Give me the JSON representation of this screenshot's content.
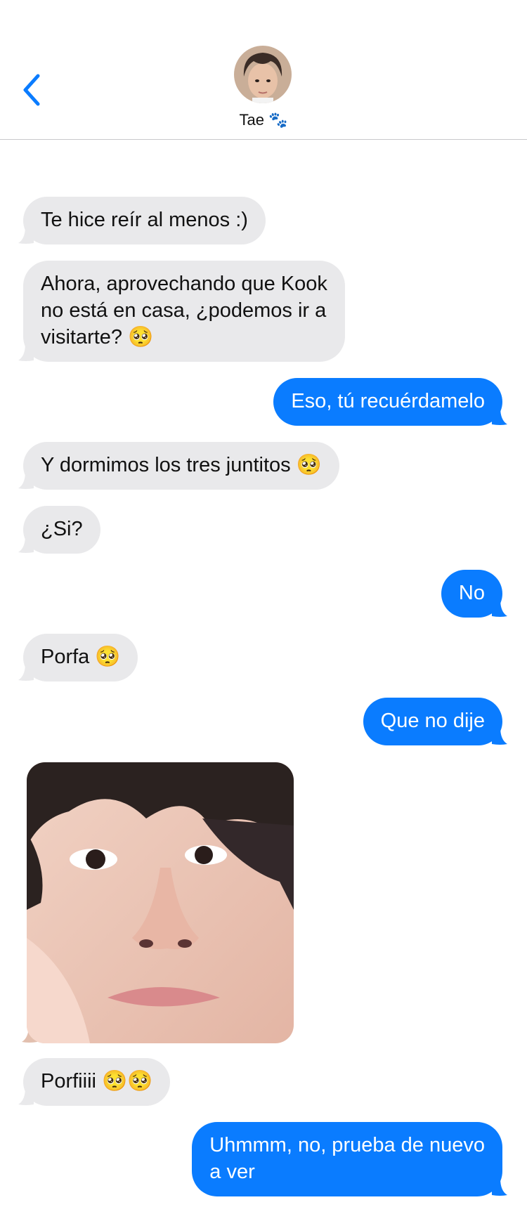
{
  "header": {
    "contact_name": "Tae 🐾",
    "back_icon": "chevron-left-icon",
    "accent": "#0a7cff"
  },
  "messages": [
    {
      "from": "them",
      "text": "Te hice reír al menos :)"
    },
    {
      "from": "them",
      "text": "Ahora, aprovechando que Kook\nno está en casa, ¿podemos ir a\nvisitarte? 🥺"
    },
    {
      "from": "me",
      "text": "Eso, tú recuérdamelo"
    },
    {
      "from": "them",
      "text": "Y dormimos los tres juntitos 🥺"
    },
    {
      "from": "them",
      "text": "¿Si?"
    },
    {
      "from": "me",
      "text": "No"
    },
    {
      "from": "them",
      "text": "Porfa 🥺"
    },
    {
      "from": "me",
      "text": "Que no dije"
    },
    {
      "from": "them",
      "type": "image"
    },
    {
      "from": "them",
      "text": "Porfiiii 🥺🥺"
    },
    {
      "from": "me",
      "text": "Uhmmm, no, prueba de nuevo\na ver"
    }
  ],
  "colors": {
    "incoming_bubble": "#e9e9eb",
    "outgoing_bubble": "#0a7cff"
  }
}
